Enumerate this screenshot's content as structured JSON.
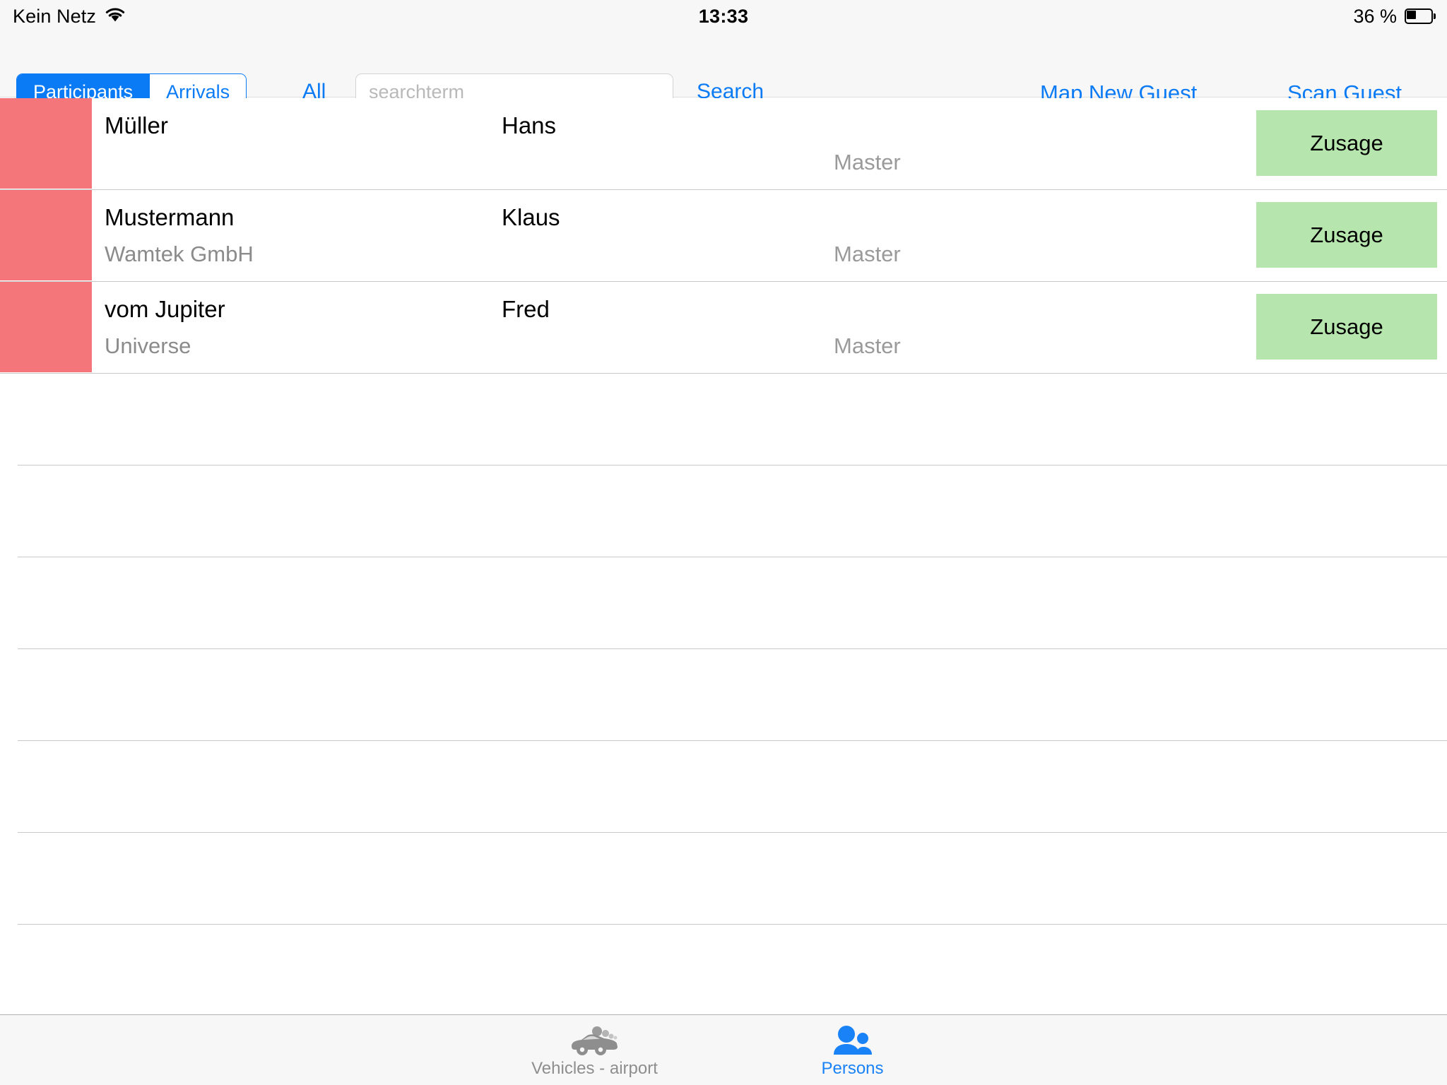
{
  "status_bar": {
    "carrier": "Kein Netz",
    "wifi_icon": "wifi-icon",
    "time": "13:33",
    "battery_percent": "36 %",
    "battery_icon": "battery-icon"
  },
  "toolbar": {
    "segmented": {
      "options": [
        {
          "label": "Participants",
          "selected": true
        },
        {
          "label": "Arrivals",
          "selected": false
        }
      ]
    },
    "all_filter_label": "All",
    "search": {
      "placeholder": "searchterm",
      "value": ""
    },
    "search_button_label": "Search",
    "map_new_guest_label": "Map New Guest",
    "scan_guest_label": "Scan Guest"
  },
  "colors": {
    "accent_blue": "#0b7bf5",
    "flag_red": "#f4757a",
    "status_green": "#b6e6ad",
    "toolbar_bg": "#f7f7f7",
    "separator": "#c8c8c8",
    "muted_text": "#8b8b8b"
  },
  "table": {
    "columns": [
      "last_name",
      "first_name",
      "role",
      "status"
    ],
    "rows": [
      {
        "flag": true,
        "last_name": "Müller",
        "organization": "",
        "first_name": "Hans",
        "role": "Master",
        "status_label": "Zusage"
      },
      {
        "flag": true,
        "last_name": "Mustermann",
        "organization": "Wamtek GmbH",
        "first_name": "Klaus",
        "role": "Master",
        "status_label": "Zusage"
      },
      {
        "flag": true,
        "last_name": "vom Jupiter",
        "organization": "Universe",
        "first_name": "Fred",
        "role": "Master",
        "status_label": "Zusage"
      }
    ],
    "empty_row_count": 6
  },
  "tab_bar": {
    "tabs": [
      {
        "label": "Vehicles - airport",
        "icon": "car-icon",
        "active": false
      },
      {
        "label": "Persons",
        "icon": "persons-icon",
        "active": true
      }
    ]
  }
}
